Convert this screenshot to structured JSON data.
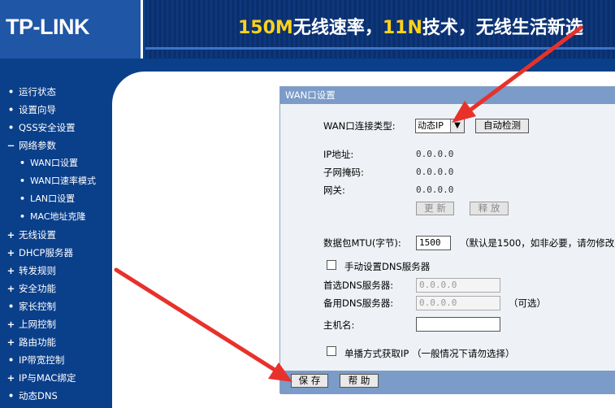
{
  "header": {
    "logo": "TP-LINK",
    "slogan_a": "150M",
    "slogan_b": "无线速率，",
    "slogan_c": "11N",
    "slogan_d": "技术，无线生活新选"
  },
  "sidebar": {
    "items": [
      {
        "marker": "•",
        "label": "运行状态",
        "sub": false
      },
      {
        "marker": "•",
        "label": "设置向导",
        "sub": false
      },
      {
        "marker": "•",
        "label": "QSS安全设置",
        "sub": false
      },
      {
        "marker": "−",
        "label": "网络参数",
        "sub": false
      },
      {
        "marker": "•",
        "label": "WAN口设置",
        "sub": true
      },
      {
        "marker": "•",
        "label": "WAN口速率模式",
        "sub": true
      },
      {
        "marker": "•",
        "label": "LAN口设置",
        "sub": true
      },
      {
        "marker": "•",
        "label": "MAC地址克隆",
        "sub": true
      },
      {
        "marker": "+",
        "label": "无线设置",
        "sub": false
      },
      {
        "marker": "+",
        "label": "DHCP服务器",
        "sub": false
      },
      {
        "marker": "+",
        "label": "转发规则",
        "sub": false
      },
      {
        "marker": "+",
        "label": "安全功能",
        "sub": false
      },
      {
        "marker": "•",
        "label": "家长控制",
        "sub": false
      },
      {
        "marker": "+",
        "label": "上网控制",
        "sub": false
      },
      {
        "marker": "+",
        "label": "路由功能",
        "sub": false
      },
      {
        "marker": "•",
        "label": "IP带宽控制",
        "sub": false
      },
      {
        "marker": "+",
        "label": "IP与MAC绑定",
        "sub": false
      },
      {
        "marker": "•",
        "label": "动态DNS",
        "sub": false
      }
    ]
  },
  "form": {
    "title": "WAN口设置",
    "conn_type_label": "WAN口连接类型:",
    "conn_type_value": "动态IP",
    "auto_detect": "自动检测",
    "ip_label": "IP地址:",
    "ip_value": "0.0.0.0",
    "mask_label": "子网掩码:",
    "mask_value": "0.0.0.0",
    "gateway_label": "网关:",
    "gateway_value": "0.0.0.0",
    "renew": "更 新",
    "release": "释 放",
    "mtu_label": "数据包MTU(字节):",
    "mtu_value": "1500",
    "mtu_hint": "（默认是1500，如非必要，请勿修改",
    "manual_dns_label": "手动设置DNS服务器",
    "dns1_label": "首选DNS服务器:",
    "dns1_value": "0.0.0.0",
    "dns2_label": "备用DNS服务器:",
    "dns2_value": "0.0.0.0",
    "dns2_hint": "（可选）",
    "host_label": "主机名:",
    "host_value": "",
    "unicast_label": "单播方式获取IP （一般情况下请勿选择）",
    "save": "保 存",
    "help": "帮 助"
  },
  "colors": {
    "nav_bg": "#0a3f8a",
    "box_title": "#7b9bc8",
    "arrow": "#e8312a",
    "slogan_accent": "#ffd21a"
  }
}
